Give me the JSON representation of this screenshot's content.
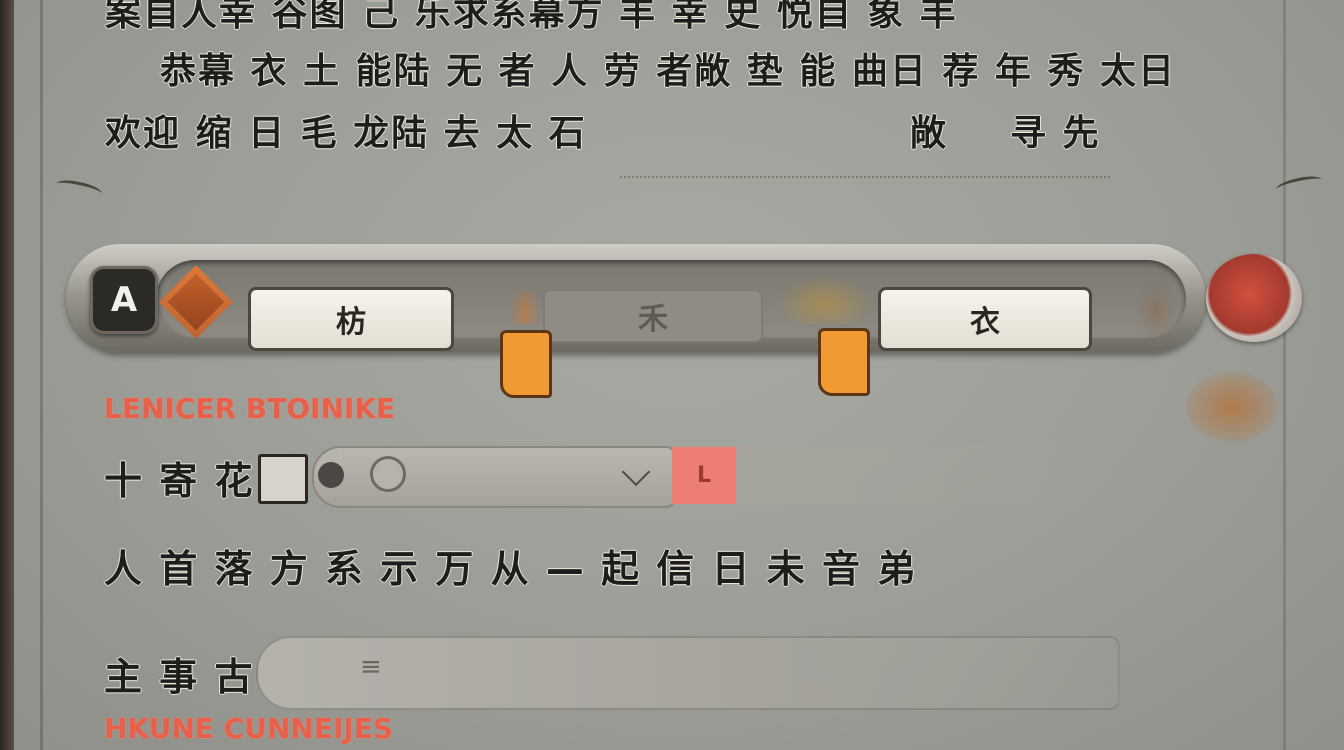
{
  "intro": {
    "line1": "案自人幸 谷图 己 乐求系幕方 丰 幸 史 悦自 象 丰",
    "line2": "恭幕 衣 土 能陆 无 者 人 劳 者敞 垫 能 曲日 荐 年 秀 太日",
    "line3": "欢迎 缩 日 毛 龙陆 去 太 石",
    "line3_mid": "敞",
    "line3_right": "寻 先"
  },
  "selector": {
    "lock_label": "A",
    "option_left": "枋",
    "option_mid": "禾",
    "option_right": "衣"
  },
  "sections": {
    "title1": "LENICER BTOINIKE",
    "title2": "HKUNE CUNNEIJES"
  },
  "rows": {
    "row1_label": "十 寄 花",
    "row1_button": "L",
    "row2_text": "人 首 落 方 系 示 万 从 — 起 信 日 未 音 弟",
    "row3_label": "主 事 古",
    "row3_bar_glyph": "≡"
  },
  "colors": {
    "accent_orange": "#f09a34",
    "section_red": "#e8604a",
    "pink_button": "#ee7d73"
  }
}
